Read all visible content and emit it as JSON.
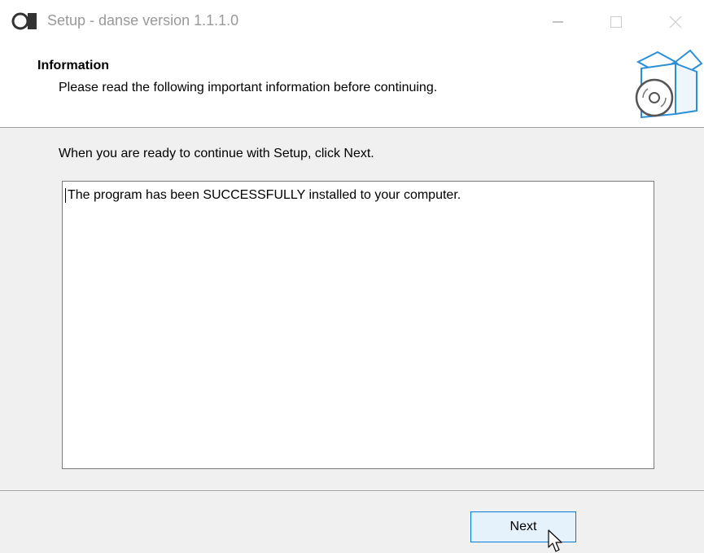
{
  "window": {
    "title": "Setup - danse version 1.1.1.0",
    "controls": [
      "minimize-icon",
      "maximize-icon",
      "close-icon"
    ]
  },
  "header": {
    "title": "Information",
    "subtitle": "Please read the following important information before continuing.",
    "graphic": "installer-box-icon"
  },
  "body": {
    "instruction": "When you are ready to continue with Setup, click Next.",
    "info_text": "The program has been SUCCESSFULLY installed to your computer."
  },
  "buttons": {
    "next_label": "Next"
  },
  "colors": {
    "accent": "#0078d7",
    "button_hover_bg": "#e5f1fb",
    "dialog_bg": "#f0f0f0"
  }
}
